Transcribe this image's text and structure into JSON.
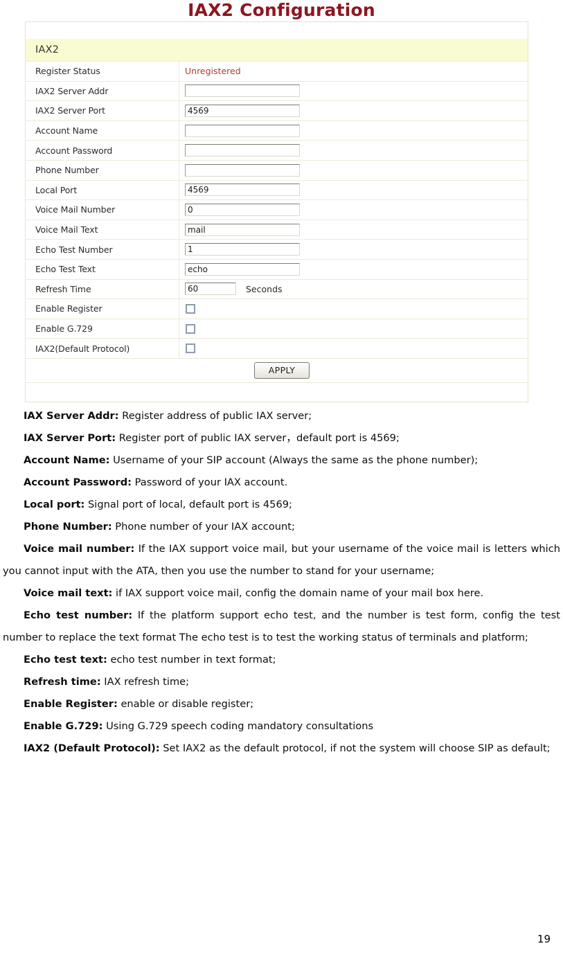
{
  "page": {
    "title": "IAX2 Configuration",
    "number": "19"
  },
  "config_panel": {
    "section_title": "IAX2",
    "status_color": "#b33a33",
    "rows": [
      {
        "label": "Register Status",
        "type": "status",
        "value": "Unregistered"
      },
      {
        "label": "IAX2 Server Addr",
        "type": "text",
        "value": ""
      },
      {
        "label": "IAX2 Server Port",
        "type": "text",
        "value": "4569"
      },
      {
        "label": "Account Name",
        "type": "text",
        "value": ""
      },
      {
        "label": "Account Password",
        "type": "text",
        "value": ""
      },
      {
        "label": "Phone Number",
        "type": "text",
        "value": ""
      },
      {
        "label": "Local Port",
        "type": "text",
        "value": "4569"
      },
      {
        "label": "Voice Mail Number",
        "type": "text",
        "value": "0"
      },
      {
        "label": "Voice Mail Text",
        "type": "text",
        "value": "mail"
      },
      {
        "label": "Echo Test Number",
        "type": "text",
        "value": "1"
      },
      {
        "label": "Echo Test Text",
        "type": "text",
        "value": "echo"
      },
      {
        "label": "Refresh Time",
        "type": "text",
        "value": "60",
        "unit": "Seconds"
      },
      {
        "label": "Enable Register",
        "type": "checkbox",
        "checked": false
      },
      {
        "label": "Enable G.729",
        "type": "checkbox",
        "checked": false
      },
      {
        "label": "IAX2(Default Protocol)",
        "type": "checkbox",
        "checked": false
      }
    ],
    "apply_label": "APPLY"
  },
  "descriptions": [
    {
      "term": "IAX Server Addr:",
      "text": " Register address of public IAX server;"
    },
    {
      "term": "IAX Server Port:",
      "text": " Register port of public IAX server，default port is 4569;"
    },
    {
      "term": "Account Name:",
      "text": " Username of your SIP account (Always the same as the phone number);"
    },
    {
      "term": "Account Password:",
      "text": " Password of your IAX account."
    },
    {
      "term": "Local port:",
      "text": " Signal port of local, default port is 4569;"
    },
    {
      "term": "Phone Number:",
      "text": " Phone number of your IAX account;"
    },
    {
      "term": "Voice mail number:",
      "text": " If the IAX support voice mail, but your username of the voice mail is letters which you cannot input with the ATA, then you use the number to stand for your username;"
    },
    {
      "term": "Voice mail text:",
      "text": " if IAX support voice mail, config the domain name of your mail box here."
    },
    {
      "term": "Echo test number:",
      "text": " If the platform support echo test, and the number is test form, config the test number to replace the text format The echo test is to test the working status of terminals and platform;"
    },
    {
      "term": "Echo test text:",
      "text": " echo test number in text format;"
    },
    {
      "term": "Refresh time:",
      "text": " IAX refresh time;"
    },
    {
      "term": "Enable Register:",
      "text": " enable or disable register;"
    },
    {
      "term": "Enable G.729:",
      "text": " Using G.729 speech coding mandatory consultations"
    },
    {
      "term": "IAX2 (Default Protocol):",
      "text": " Set IAX2 as the default protocol, if not the system will choose SIP as default;"
    }
  ]
}
